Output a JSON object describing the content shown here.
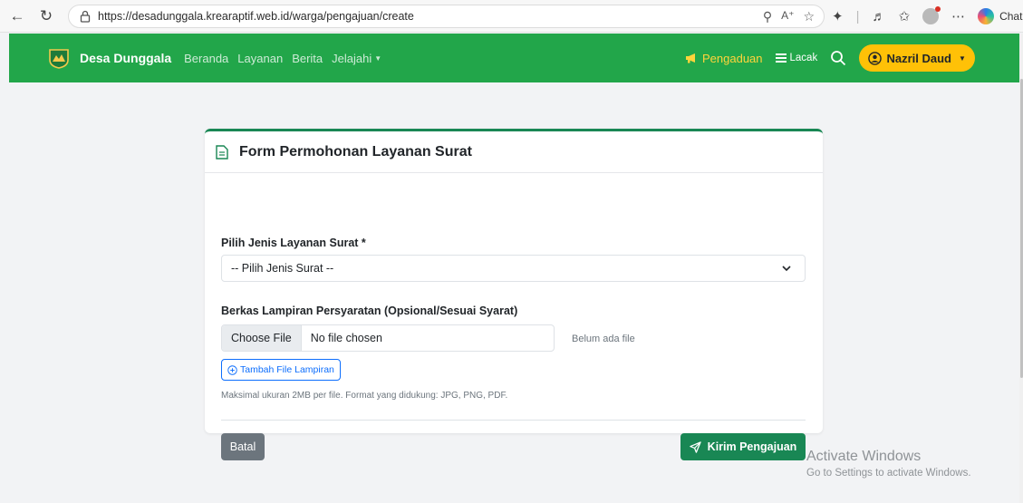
{
  "browser": {
    "url": "https://desadunggala.krearaptif.web.id/warga/pengajuan/create",
    "chat_label": "Chat"
  },
  "navbar": {
    "brand": "Desa Dunggala",
    "links": [
      "Beranda",
      "Layanan",
      "Berita",
      "Jelajahi"
    ],
    "pengaduan": "Pengaduan",
    "lacak": "Lacak",
    "user": "Nazril Daud"
  },
  "form": {
    "title": "Form Permohonan Layanan Surat",
    "service_label": "Pilih Jenis Layanan Surat *",
    "service_selected": "-- Pilih Jenis Surat --",
    "attachment_label": "Berkas Lampiran Persyaratan (Opsional/Sesuai Syarat)",
    "choose_file": "Choose File",
    "no_file": "No file chosen",
    "file_status": "Belum ada file",
    "add_file": "Tambah File Lampiran",
    "hint": "Maksimal ukuran 2MB per file. Format yang didukung: JPG, PNG, PDF.",
    "cancel": "Batal",
    "submit": "Kirim Pengajuan"
  },
  "watermark": {
    "title": "Activate Windows",
    "subtitle": "Go to Settings to activate Windows."
  },
  "colors": {
    "navbar": "#22a64a",
    "user_button": "#ffc107",
    "submit": "#198754",
    "cancel": "#6c757d",
    "link_blue": "#0d6efd"
  }
}
